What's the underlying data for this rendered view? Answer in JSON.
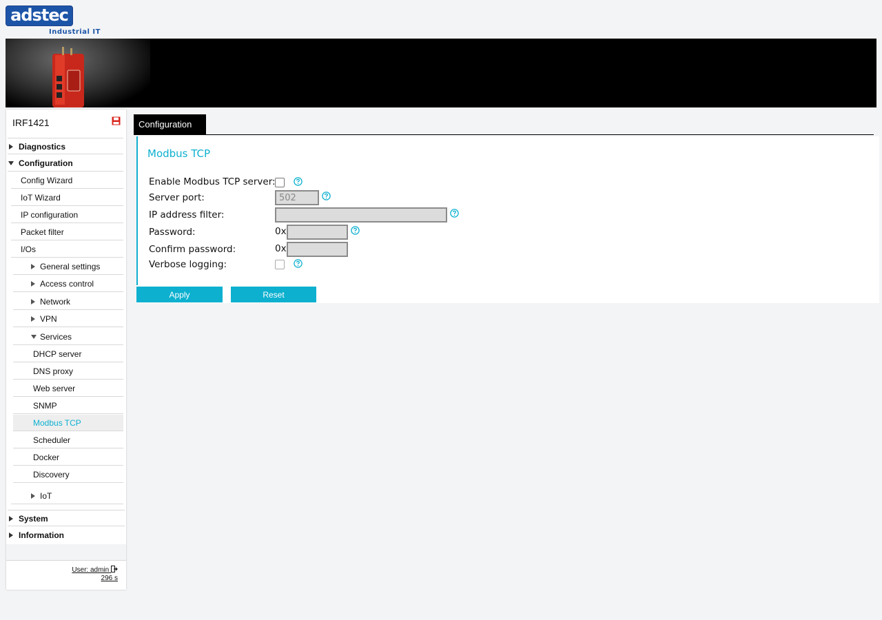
{
  "brand": {
    "logo_main": "ads",
    "logo_accent": "tec",
    "logo_sub": "Industrial IT"
  },
  "device": {
    "name": "IRF1421"
  },
  "nav": {
    "diagnostics": "Diagnostics",
    "configuration": "Configuration",
    "config_wizard": "Config Wizard",
    "iot_wizard": "IoT Wizard",
    "ip_configuration": "IP configuration",
    "packet_filter": "Packet filter",
    "ios": "I/Os",
    "general_settings": "General settings",
    "access_control": "Access control",
    "network": "Network",
    "vpn": "VPN",
    "services": "Services",
    "dhcp_server": "DHCP server",
    "dns_proxy": "DNS proxy",
    "web_server": "Web server",
    "snmp": "SNMP",
    "modbus_tcp": "Modbus TCP",
    "scheduler": "Scheduler",
    "docker": "Docker",
    "discovery": "Discovery",
    "iot": "IoT",
    "system": "System",
    "information": "Information"
  },
  "session": {
    "user": "User: admin",
    "timer": "296 s"
  },
  "tab": {
    "label": "Configuration"
  },
  "form": {
    "title": "Modbus TCP",
    "enable_label": "Enable Modbus TCP server:",
    "enable_checked": false,
    "port_label": "Server port:",
    "port_value": "502",
    "ipfilter_label": "IP address filter:",
    "ipfilter_value": "",
    "password_label": "Password:",
    "password_prefix": "0x",
    "confirm_label": "Confirm password:",
    "confirm_prefix": "0x",
    "verbose_label": "Verbose logging:",
    "verbose_checked": false
  },
  "buttons": {
    "apply": "Apply",
    "reset": "Reset"
  },
  "colors": {
    "accent": "#0db0cf",
    "brand": "#1c55a7",
    "save": "#d9261c"
  }
}
